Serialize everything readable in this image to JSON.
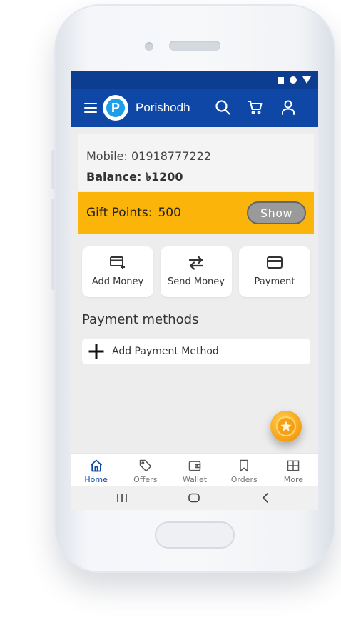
{
  "app": {
    "title": "Porishodh",
    "logo_letter": "P"
  },
  "account": {
    "mobile_label": "Mobile:",
    "mobile_value": "01918777222",
    "balance_label": "Balance:",
    "balance_value": "৳1200"
  },
  "gift": {
    "label": "Gift Points:",
    "value": "500",
    "show_label": "Show"
  },
  "actions": [
    {
      "label": "Add Money",
      "icon": "add-card-icon"
    },
    {
      "label": "Send Money",
      "icon": "transfer-arrows-icon"
    },
    {
      "label": "Payment",
      "icon": "credit-card-icon"
    }
  ],
  "payment_methods": {
    "title": "Payment methods",
    "add_label": "Add Payment Method"
  },
  "nav": [
    {
      "label": "Home",
      "icon": "home-icon",
      "active": true
    },
    {
      "label": "Offers",
      "icon": "tag-icon"
    },
    {
      "label": "Wallet",
      "icon": "wallet-icon"
    },
    {
      "label": "Orders",
      "icon": "bookmark-icon"
    },
    {
      "label": "More",
      "icon": "grid-icon"
    }
  ],
  "colors": {
    "primary": "#0e47a5",
    "status_bar": "#0d3d91",
    "gift_bar": "#fbb40a",
    "logo_blue": "#1d9ee8",
    "fab_orange": "#f7a51a"
  }
}
